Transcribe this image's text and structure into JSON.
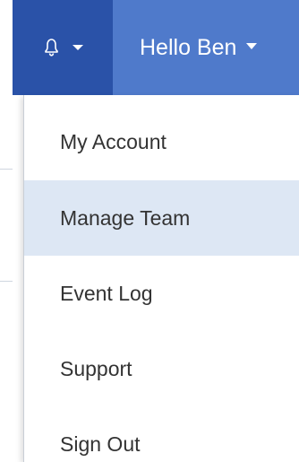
{
  "navbar": {
    "notifications_icon": "bell-icon",
    "user_menu_label": "Hello Ben",
    "colors": {
      "bell_button_bg": "#2a52a8",
      "user_button_bg": "#4f7acb",
      "text": "#ffffff"
    }
  },
  "dropdown": {
    "items": [
      {
        "label": "My Account",
        "active": false
      },
      {
        "label": "Manage Team",
        "active": true
      },
      {
        "label": "Event Log",
        "active": false
      },
      {
        "label": "Support",
        "active": false
      },
      {
        "label": "Sign Out",
        "active": false
      }
    ],
    "colors": {
      "active_bg": "#dde7f4",
      "text": "#333333"
    }
  }
}
